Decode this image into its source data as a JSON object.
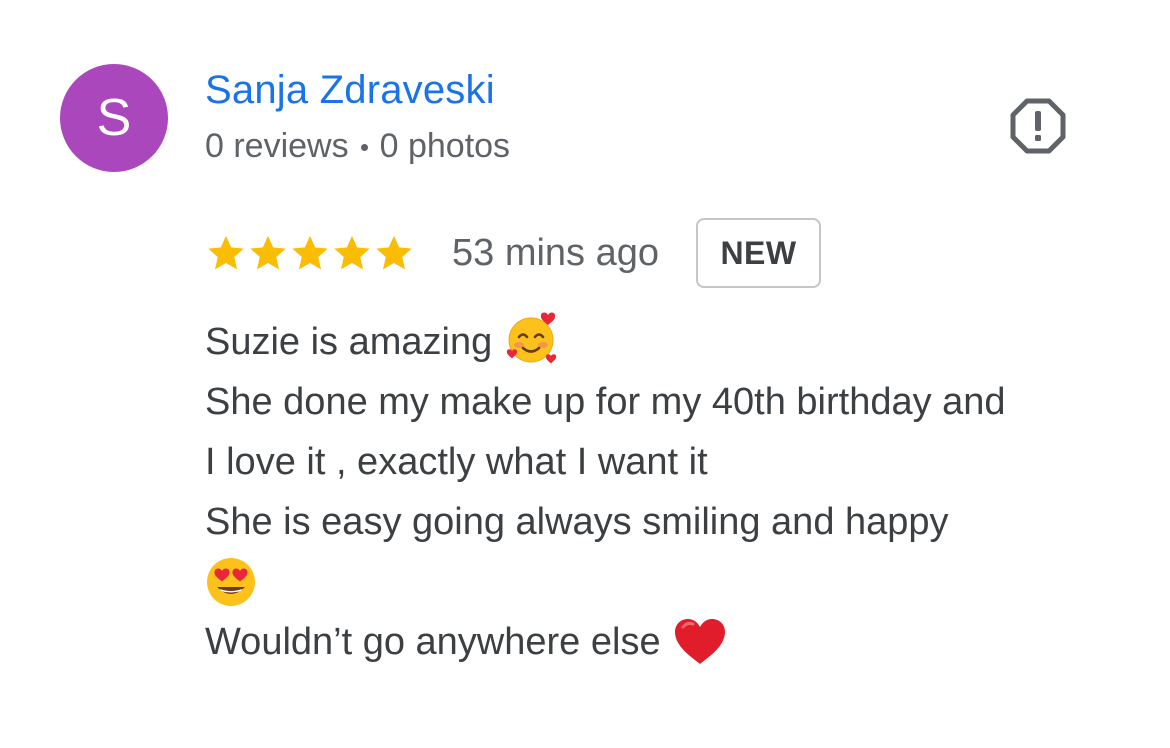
{
  "reviewer": {
    "avatar_letter": "S",
    "avatar_color": "#ab47bc",
    "name": "Sanja Zdraveski",
    "reviews_count": "0 reviews",
    "photos_count": "0 photos",
    "separator_color": "#5f6368"
  },
  "report_icon": "report-octagon-icon",
  "rating": {
    "stars": 5,
    "max_stars": 5,
    "star_color": "#fbbc04",
    "time_ago": "53 mins ago",
    "badge_label": "NEW"
  },
  "review": {
    "line1_text": "Suzie is amazing",
    "line1_emoji": "smiling-face-with-hearts-emoji",
    "line2_text": "She done my make up for my 40th birthday and",
    "line3_text": "I love it , exactly what I want it",
    "line4_text": "She is easy going always smiling and happy",
    "line5_emoji": "heart-eyes-emoji",
    "line6_text": "Wouldn’t go anywhere else",
    "line6_emoji": "red-heart-emoji"
  }
}
